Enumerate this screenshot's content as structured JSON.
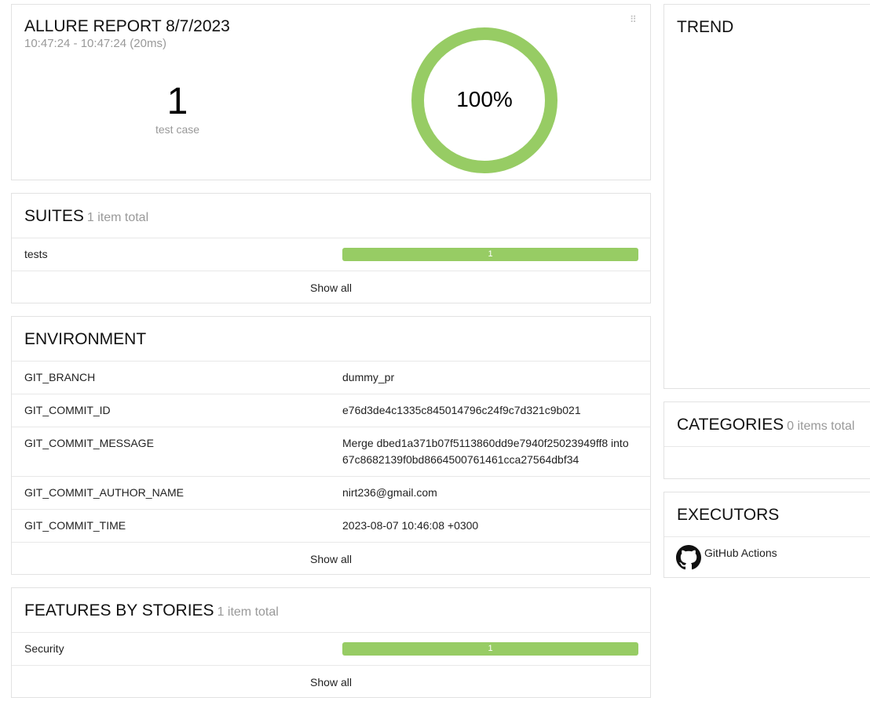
{
  "summary": {
    "title": "ALLURE REPORT 8/7/2023",
    "time_range": "10:47:24 - 10:47:24 (20ms)",
    "test_count": "1",
    "test_count_label": "test case",
    "pass_percent_label": "100%",
    "pass_fraction": 1.0,
    "ring_color": "#97cc64"
  },
  "suites": {
    "title": "SUITES",
    "count_label": "1 item total",
    "rows": [
      {
        "name": "tests",
        "bar_label": "1"
      }
    ],
    "show_all": "Show all"
  },
  "environment": {
    "title": "ENVIRONMENT",
    "rows": [
      {
        "key": "GIT_BRANCH",
        "value": "dummy_pr"
      },
      {
        "key": "GIT_COMMIT_ID",
        "value": "e76d3de4c1335c845014796c24f9c7d321c9b021"
      },
      {
        "key": "GIT_COMMIT_MESSAGE",
        "value": "Merge dbed1a371b07f5113860dd9e7940f25023949ff8 into 67c8682139f0bd8664500761461cca27564dbf34"
      },
      {
        "key": "GIT_COMMIT_AUTHOR_NAME",
        "value": "nirt236@gmail.com"
      },
      {
        "key": "GIT_COMMIT_TIME",
        "value": "2023-08-07 10:46:08 +0300"
      }
    ],
    "show_all": "Show all"
  },
  "features": {
    "title": "FEATURES BY STORIES",
    "count_label": "1 item total",
    "rows": [
      {
        "name": "Security",
        "bar_label": "1"
      }
    ],
    "show_all": "Show all"
  },
  "trend": {
    "title": "TREND"
  },
  "categories": {
    "title": "CATEGORIES",
    "count_label": "0 items total"
  },
  "executors": {
    "title": "EXECUTORS",
    "items": [
      {
        "name": "GitHub Actions",
        "icon": "github-icon"
      }
    ]
  },
  "colors": {
    "passed": "#97cc64"
  }
}
